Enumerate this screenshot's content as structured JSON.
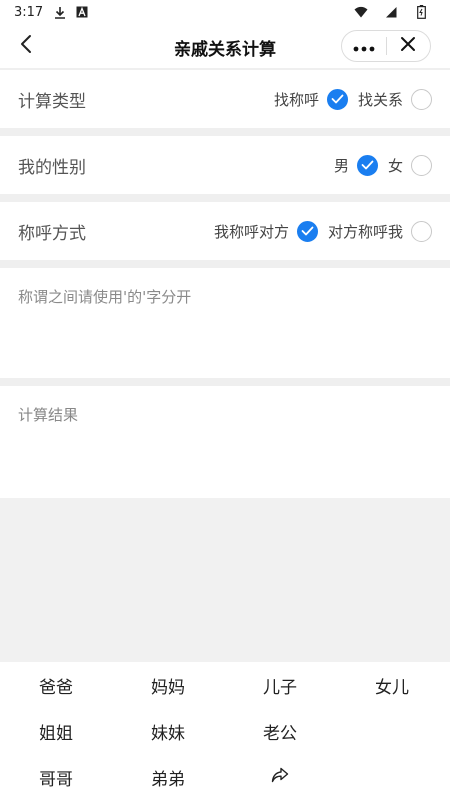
{
  "status_bar": {
    "time": "3:17",
    "icons": [
      "download-icon",
      "a-icon",
      "wifi-icon",
      "signal-icon",
      "battery-icon"
    ]
  },
  "nav": {
    "title": "亲戚关系计算",
    "back_icon": "chevron-left-icon",
    "more_icon": "more-dots-icon",
    "close_icon": "close-icon"
  },
  "rows": [
    {
      "label": "计算类型",
      "options": [
        {
          "text": "找称呼",
          "checked": true
        },
        {
          "text": "找关系",
          "checked": false
        }
      ]
    },
    {
      "label": "我的性别",
      "options": [
        {
          "text": "男",
          "checked": true
        },
        {
          "text": "女",
          "checked": false
        }
      ]
    },
    {
      "label": "称呼方式",
      "options": [
        {
          "text": "我称呼对方",
          "checked": true
        },
        {
          "text": "对方称呼我",
          "checked": false
        }
      ]
    }
  ],
  "input": {
    "placeholder": "称谓之间请使用'的'字分开",
    "value": ""
  },
  "result": {
    "label": "计算结果"
  },
  "keyboard": {
    "keys": [
      "爸爸",
      "妈妈",
      "儿子",
      "女儿",
      "姐姐",
      "妹妹",
      "老公",
      "",
      "哥哥",
      "弟弟",
      "",
      ""
    ],
    "special_icon": "share-arrow-icon"
  },
  "colors": {
    "accent": "#1a7ef0",
    "separator": "#efefef",
    "blank_area": "#f1f1f1"
  }
}
